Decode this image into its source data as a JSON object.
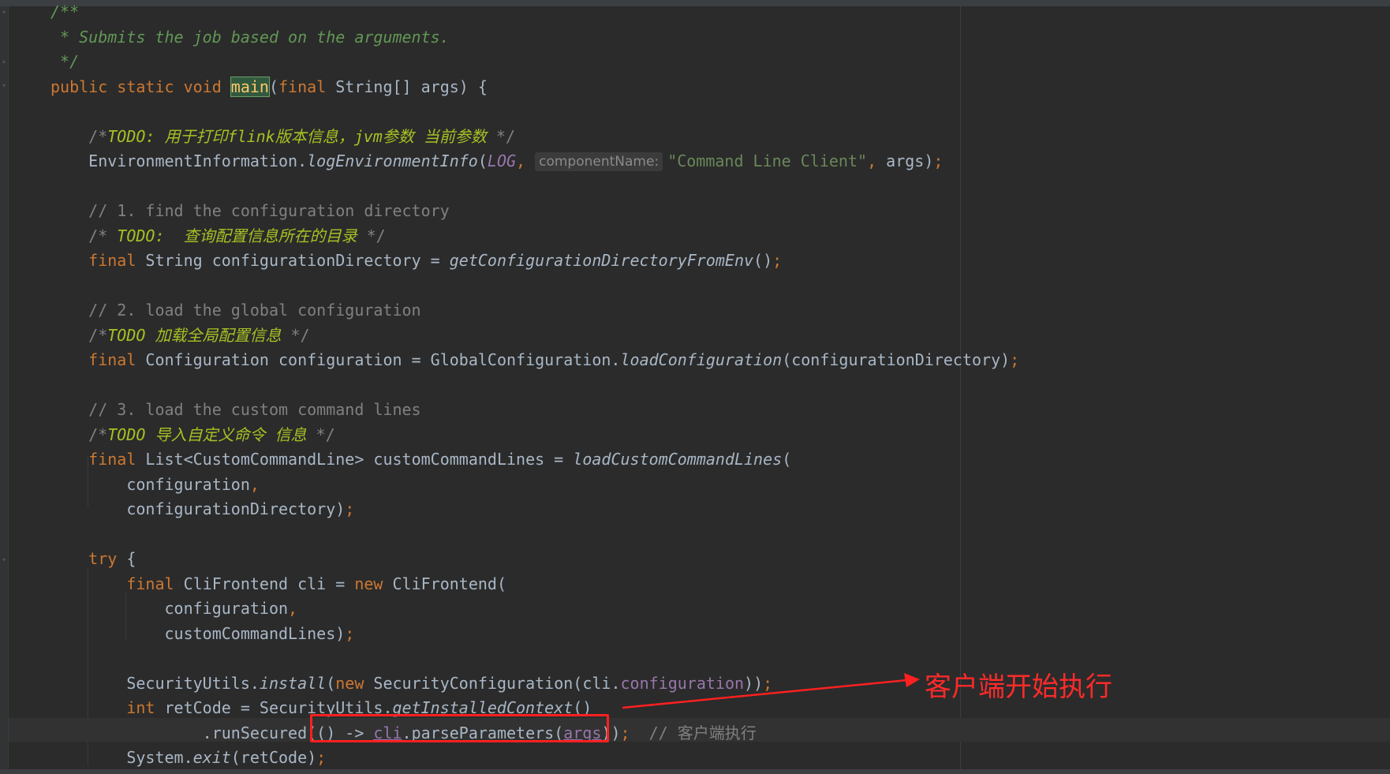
{
  "editor": {
    "lines": [
      [
        {
          "t": "/**",
          "c": "doc"
        }
      ],
      [
        {
          "t": " * Submits the job based on the arguments.",
          "c": "doc"
        }
      ],
      [
        {
          "t": " */",
          "c": "doc"
        }
      ],
      [
        {
          "t": "public static void ",
          "c": "kw"
        },
        {
          "t": "main",
          "c": "hl-main"
        },
        {
          "t": "(",
          "c": ""
        },
        {
          "t": "final ",
          "c": "kw"
        },
        {
          "t": "String[] args) {",
          "c": ""
        }
      ],
      [],
      [
        {
          "t": "    /*",
          "c": "cm"
        },
        {
          "t": "TODO: 用于打印flink版本信息，jvm参数 当前参数",
          "c": "todo"
        },
        {
          "t": " */",
          "c": "cm"
        }
      ],
      [
        {
          "t": "    EnvironmentInformation.",
          "c": ""
        },
        {
          "t": "logEnvironmentInfo",
          "c": "fn-it"
        },
        {
          "t": "(",
          "c": ""
        },
        {
          "t": "LOG",
          "c": "const"
        },
        {
          "t": ", ",
          "c": "kw"
        },
        {
          "t": "componentName:",
          "c": "hint"
        },
        {
          "t": "\"Command Line Client\"",
          "c": "str"
        },
        {
          "t": ", ",
          "c": "kw"
        },
        {
          "t": "args)",
          "c": ""
        },
        {
          "t": ";",
          "c": "kw"
        }
      ],
      [],
      [
        {
          "t": "    // 1. find the configuration directory",
          "c": "cm"
        }
      ],
      [
        {
          "t": "    /* ",
          "c": "cm"
        },
        {
          "t": "TODO:  查询配置信息所在的目录",
          "c": "todo"
        },
        {
          "t": " */",
          "c": "cm"
        }
      ],
      [
        {
          "t": "    final ",
          "c": "kw"
        },
        {
          "t": "String configurationDirectory = ",
          "c": ""
        },
        {
          "t": "getConfigurationDirectoryFromEnv",
          "c": "fn-it"
        },
        {
          "t": "()",
          "c": ""
        },
        {
          "t": ";",
          "c": "kw"
        }
      ],
      [],
      [
        {
          "t": "    // 2. load the global configuration",
          "c": "cm"
        }
      ],
      [
        {
          "t": "    /*",
          "c": "cm"
        },
        {
          "t": "TODO 加载全局配置信息",
          "c": "todo"
        },
        {
          "t": " */",
          "c": "cm"
        }
      ],
      [
        {
          "t": "    final ",
          "c": "kw"
        },
        {
          "t": "Configuration configuration = GlobalConfiguration.",
          "c": ""
        },
        {
          "t": "loadConfiguration",
          "c": "fn-it"
        },
        {
          "t": "(configurationDirectory)",
          "c": ""
        },
        {
          "t": ";",
          "c": "kw"
        }
      ],
      [],
      [
        {
          "t": "    // 3. load the custom command lines",
          "c": "cm"
        }
      ],
      [
        {
          "t": "    /*",
          "c": "cm"
        },
        {
          "t": "TODO 导入自定义命令 信息",
          "c": "todo"
        },
        {
          "t": " */",
          "c": "cm"
        }
      ],
      [
        {
          "t": "    final ",
          "c": "kw"
        },
        {
          "t": "List<CustomCommandLine> customCommandLines = ",
          "c": ""
        },
        {
          "t": "loadCustomCommandLines",
          "c": "fn-it"
        },
        {
          "t": "(",
          "c": ""
        }
      ],
      [
        {
          "t": "        configuration",
          "c": ""
        },
        {
          "t": ",",
          "c": "kw"
        }
      ],
      [
        {
          "t": "        configurationDirectory)",
          "c": ""
        },
        {
          "t": ";",
          "c": "kw"
        }
      ],
      [],
      [
        {
          "t": "    try ",
          "c": "kw"
        },
        {
          "t": "{",
          "c": ""
        }
      ],
      [
        {
          "t": "        final ",
          "c": "kw"
        },
        {
          "t": "CliFrontend cli = ",
          "c": ""
        },
        {
          "t": "new ",
          "c": "kw"
        },
        {
          "t": "CliFrontend(",
          "c": ""
        }
      ],
      [
        {
          "t": "            configuration",
          "c": ""
        },
        {
          "t": ",",
          "c": "kw"
        }
      ],
      [
        {
          "t": "            customCommandLines)",
          "c": ""
        },
        {
          "t": ";",
          "c": "kw"
        }
      ],
      [],
      [
        {
          "t": "        SecurityUtils.",
          "c": ""
        },
        {
          "t": "install",
          "c": "fn-it"
        },
        {
          "t": "(",
          "c": ""
        },
        {
          "t": "new ",
          "c": "kw"
        },
        {
          "t": "SecurityConfiguration(cli.",
          "c": ""
        },
        {
          "t": "configuration",
          "c": "field"
        },
        {
          "t": "))",
          "c": ""
        },
        {
          "t": ";",
          "c": "kw"
        }
      ],
      [
        {
          "t": "        int ",
          "c": "kw"
        },
        {
          "t": "retCode = SecurityUtils.",
          "c": ""
        },
        {
          "t": "getInstalledContext",
          "c": "fn-it"
        },
        {
          "t": "()",
          "c": ""
        }
      ],
      [
        {
          "t": "                .runSecured(() -> ",
          "c": ""
        },
        {
          "t": "cli",
          "c": "uline"
        },
        {
          "t": ".parseParameters(",
          "c": ""
        },
        {
          "t": "args",
          "c": "uline"
        },
        {
          "t": "))",
          "c": ""
        },
        {
          "t": ";  ",
          "c": "kw"
        },
        {
          "t": "// 客户端执行",
          "c": "cm"
        }
      ],
      [
        {
          "t": "        System.",
          "c": ""
        },
        {
          "t": "exit",
          "c": "fn-it"
        },
        {
          "t": "(retCode)",
          "c": ""
        },
        {
          "t": ";",
          "c": "kw"
        }
      ]
    ]
  },
  "annotation": {
    "label": "客户端开始执行",
    "color": "#ff2020"
  },
  "icons": [
    "fold-marker-icon"
  ]
}
